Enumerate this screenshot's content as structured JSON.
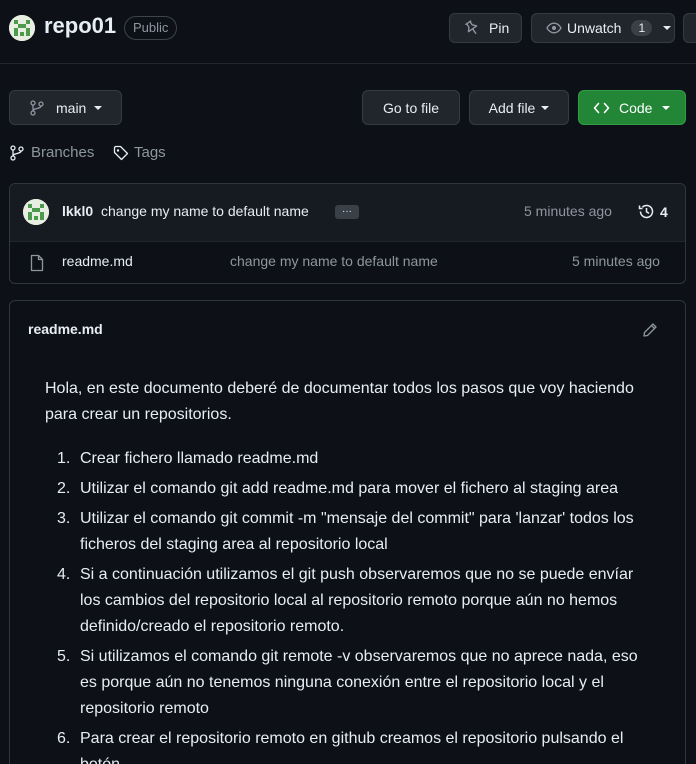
{
  "repo": {
    "name": "repo01",
    "visibility": "Public"
  },
  "header_actions": {
    "pin_label": "Pin",
    "unwatch_label": "Unwatch",
    "watch_count": "1"
  },
  "toolbar": {
    "branch": "main",
    "go_to_file": "Go to file",
    "add_file": "Add file",
    "code": "Code"
  },
  "nav": {
    "branches": "Branches",
    "tags": "Tags"
  },
  "commit": {
    "author": "lkkl0",
    "message": "change my name to default name",
    "ellipsis": "···",
    "time": "5 minutes ago",
    "count": "4"
  },
  "files": [
    {
      "name": "readme.md",
      "message": "change my name to default name",
      "time": "5 minutes ago"
    }
  ],
  "readme": {
    "title": "readme.md",
    "intro": "Hola, en este documento deberé de documentar todos los pasos que voy haciendo para crear un repositorios.",
    "steps": [
      {
        "n": "1.",
        "text": "Crear fichero llamado readme.md"
      },
      {
        "n": "2.",
        "text": "Utilizar el comando git add readme.md para mover el fichero al staging area"
      },
      {
        "n": "3.",
        "text": "Utilizar el comando git commit -m \"mensaje del commit\" para 'lanzar' todos los ficheros del staging area al repositorio local"
      },
      {
        "n": "4.",
        "text": "Si a continuación utilizamos el git push observaremos que no se puede envíar los cambios del repositorio local al repositorio remoto porque aún no hemos definido/creado el repositorio remoto."
      },
      {
        "n": "5.",
        "text": "Si utilizamos el comando git remote -v observaremos que no aprece nada, eso es porque aún no tenemos ninguna conexión entre el repositorio local y el repositorio remoto"
      },
      {
        "n": "6.",
        "text": "Para crear el repositorio remoto en github creamos el repositorio pulsando el botón"
      }
    ]
  },
  "colors": {
    "background": "#0d1117",
    "button_bg": "#21262d",
    "border": "#30363d",
    "code_green": "#238636",
    "muted_text": "#8d96a0"
  }
}
